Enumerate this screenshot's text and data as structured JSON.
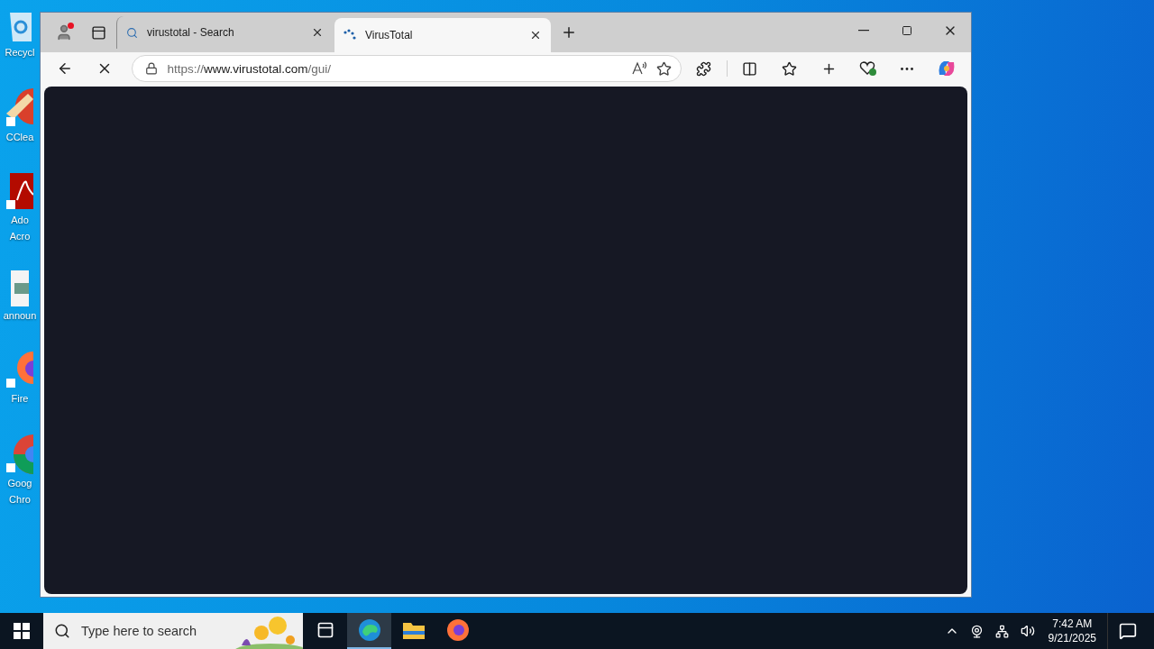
{
  "desktop_icons": [
    {
      "kind": "recycle",
      "lines": [
        "Recycl"
      ]
    },
    {
      "kind": "ccleaner",
      "lines": [
        "CClea"
      ]
    },
    {
      "kind": "acrobat",
      "lines": [
        "Ado",
        "Acro"
      ]
    },
    {
      "kind": "image",
      "lines": [
        "announ"
      ]
    },
    {
      "kind": "firefox",
      "lines": [
        "Fire"
      ]
    },
    {
      "kind": "chrome",
      "lines": [
        "Goog",
        "Chro"
      ]
    }
  ],
  "browser": {
    "profile_notification": true,
    "tabs": [
      {
        "kind": "search",
        "title": "virustotal - Search",
        "selected": false
      },
      {
        "kind": "loading",
        "title": "VirusTotal",
        "selected": true
      }
    ],
    "loading": true,
    "address": {
      "scheme": "https://",
      "host": "www.virustotal.com",
      "path": "/gui/"
    }
  },
  "taskbar": {
    "search_placeholder": "Type here to search",
    "apps": [
      {
        "kind": "taskview",
        "selected": false
      },
      {
        "kind": "edge",
        "selected": true
      },
      {
        "kind": "explorer",
        "selected": false
      },
      {
        "kind": "firefox",
        "selected": false
      }
    ],
    "time": "7:42 AM",
    "date": "9/21/2025"
  }
}
